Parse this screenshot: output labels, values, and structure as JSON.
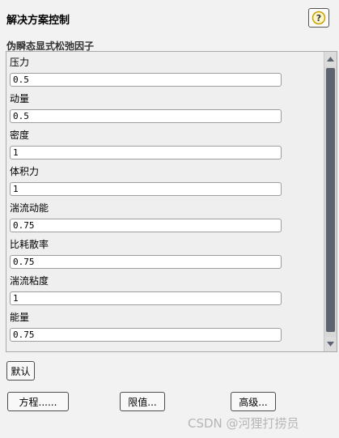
{
  "dialog": {
    "title": "解决方案控制",
    "help_icon": "question-mark-icon"
  },
  "group": {
    "title": "伪瞬态显式松弛因子"
  },
  "fields": [
    {
      "label": "压力",
      "value": "0.5"
    },
    {
      "label": "动量",
      "value": "0.5"
    },
    {
      "label": "密度",
      "value": "1"
    },
    {
      "label": "体积力",
      "value": "1"
    },
    {
      "label": "湍流动能",
      "value": "0.75"
    },
    {
      "label": "比耗散率",
      "value": "0.75"
    },
    {
      "label": "湍流粘度",
      "value": "1"
    },
    {
      "label": "能量",
      "value": "0.75"
    }
  ],
  "buttons": {
    "default": "默认",
    "equations": "方程......",
    "limits": "限值...",
    "advanced": "高级..."
  },
  "watermark": "CSDN @河狸打捞员",
  "colors": {
    "background": "#f2f2f2",
    "help_icon": "#c8a000",
    "scroll_thumb": "#5d6470"
  }
}
